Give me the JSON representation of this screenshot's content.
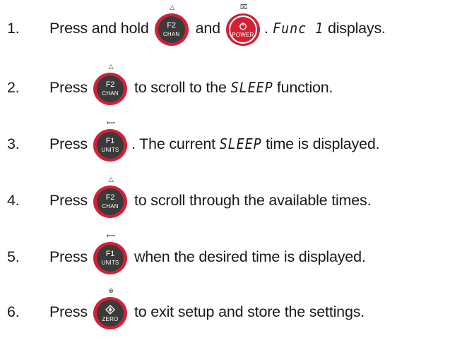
{
  "steps": [
    {
      "num": "1.",
      "parts": {
        "a": "Press and hold",
        "b": "and",
        "c": ".",
        "seg": "Func 1",
        "d": "displays."
      }
    },
    {
      "num": "2.",
      "parts": {
        "a": "Press",
        "b": "to scroll to the",
        "seg": "SLEEP",
        "c": "function."
      }
    },
    {
      "num": "3.",
      "parts": {
        "a": "Press",
        "b": ". The current",
        "seg": "SLEEP",
        "c": "time is displayed."
      }
    },
    {
      "num": "4.",
      "parts": {
        "a": "Press",
        "b": "to scroll through the available times."
      }
    },
    {
      "num": "5.",
      "parts": {
        "a": "Press",
        "b": "when the desired time is displayed."
      }
    },
    {
      "num": "6.",
      "parts": {
        "a": "Press",
        "b": "to exit setup and store the settings."
      }
    }
  ],
  "buttons": {
    "f2": {
      "main": "F2",
      "sub": "CHAN",
      "mark": "△",
      "icon": "f2-chan-icon"
    },
    "f1": {
      "main": "F1",
      "sub": "UNITS",
      "mark": "⟸",
      "icon": "f1-units-icon"
    },
    "power": {
      "sub": "POWER",
      "mark": "⌧",
      "icon": "power-icon"
    },
    "zero": {
      "sub": "ZERO",
      "mark": "⊗",
      "icon": "zero-icon"
    }
  },
  "colors": {
    "button_red": "#d32035",
    "button_face": "#3a3a3a",
    "text": "#1a1a1a"
  }
}
